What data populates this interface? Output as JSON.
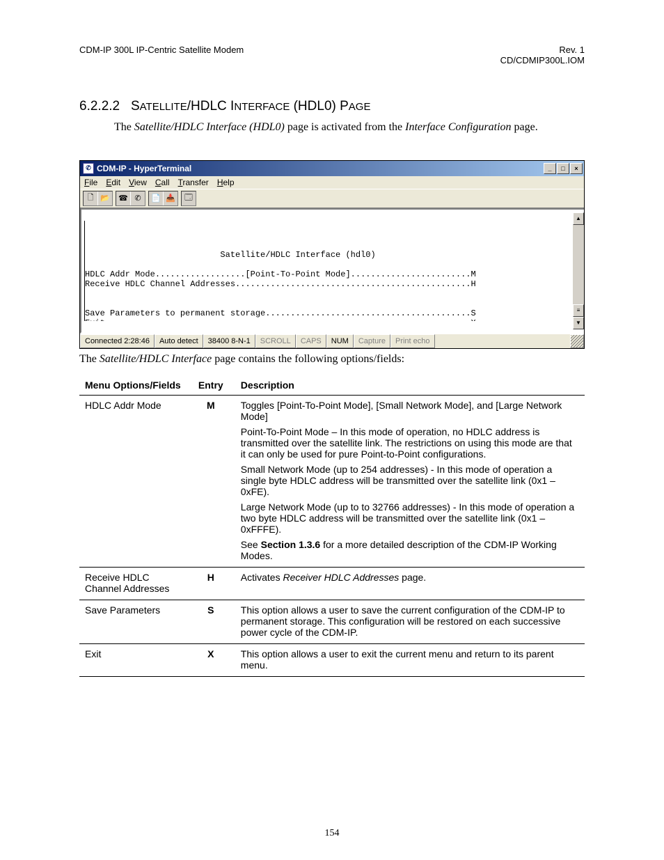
{
  "header": {
    "left": "CDM-IP 300L IP-Centric Satellite Modem",
    "right_line1": "Rev. 1",
    "right_line2": "CD/CDMIP300L.IOM"
  },
  "section": {
    "number": "6.2.2.2",
    "title_html": "Sᴀᴛᴇʟʟɪᴛᴇ/HDLC Iɴᴛᴇʀғᴀᴄᴇ (HDL0) Pᴀɢᴇ",
    "title_plain": "SATELLITE/HDLC INTERFACE (HDL0) PAGE"
  },
  "intro": {
    "prefix": "The ",
    "em1": "Satellite/HDLC Interface (HDL0)",
    "mid": " page is activated from the ",
    "em2": "Interface Configuration",
    "suffix": " page."
  },
  "ht": {
    "title": "CDM-IP - HyperTerminal",
    "menus": [
      "File",
      "Edit",
      "View",
      "Call",
      "Transfer",
      "Help"
    ],
    "terminal_lines": [
      "",
      "",
      "",
      "                           Satellite/HDLC Interface (hdl0)",
      "",
      "HDLC Addr Mode..................[Point-To-Point Mode]........................M",
      "Receive HDLC Channel Addresses...............................................H",
      "",
      "",
      "Save Parameters to permanent storage.........................................S",
      "Exit.........................................................................X",
      "-"
    ],
    "status": {
      "connected": "Connected 2:28:46",
      "autodetect": "Auto detect",
      "baud": "38400 8-N-1",
      "scroll": "SCROLL",
      "caps": "CAPS",
      "num": "NUM",
      "capture": "Capture",
      "printecho": "Print echo"
    }
  },
  "caption": {
    "prefix": "The ",
    "em": "Satellite/HDLC Interface",
    "suffix": " page contains the following options/fields:"
  },
  "table": {
    "headers": {
      "c1": "Menu Options/Fields",
      "c2": "Entry",
      "c3": "Description"
    },
    "rows": [
      {
        "field": "HDLC Addr Mode",
        "entry": "M",
        "desc": [
          {
            "text": "Toggles [Point-To-Point Mode], [Small Network Mode], and [Large Network Mode]"
          },
          {
            "text": "Point-To-Point Mode – In this mode of operation, no HDLC address is transmitted over the satellite link. The restrictions on using this mode are that it can only be used for pure Point-to-Point configurations."
          },
          {
            "text": "Small Network Mode (up to 254 addresses) - In this mode of operation a single byte HDLC address will be transmitted over the satellite link (0x1 – 0xFE)."
          },
          {
            "text": "Large Network Mode (up to to 32766 addresses) - In this mode of operation a two byte HDLC address will be transmitted over the satellite link (0x1 – 0xFFFE)."
          },
          {
            "pre": "See ",
            "bold": "Section  1.3.6",
            "post": " for a more detailed description of the CDM-IP Working Modes."
          }
        ]
      },
      {
        "field": "Receive HDLC Channel Addresses",
        "entry": "H",
        "desc": [
          {
            "pre": "Activates ",
            "em": "Receiver HDLC Addresses",
            "post": " page."
          }
        ]
      },
      {
        "field": "Save Parameters",
        "entry": "S",
        "desc": [
          {
            "text": "This option allows a user to save the current configuration of the CDM-IP to permanent storage. This configuration will be restored on each successive power cycle of the CDM-IP."
          }
        ]
      },
      {
        "field": "Exit",
        "entry": "X",
        "desc": [
          {
            "text": "This option allows a user to exit the current menu and return to its parent menu."
          }
        ]
      }
    ]
  },
  "page_number": "154"
}
